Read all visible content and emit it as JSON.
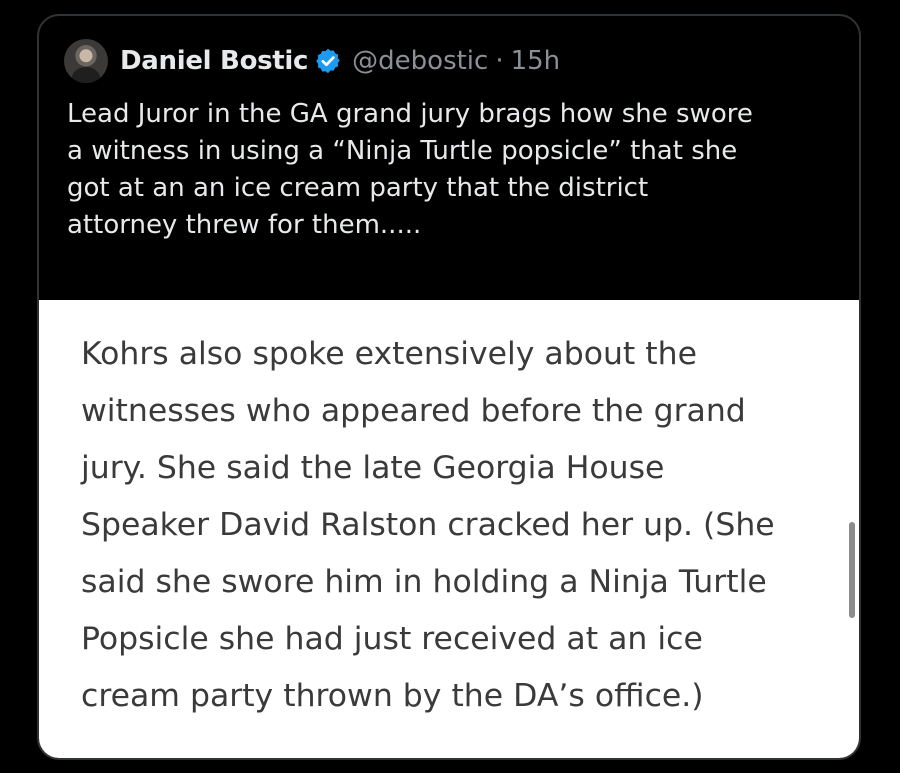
{
  "post": {
    "author_name": "Daniel Bostic",
    "handle": "@debostic",
    "separator": "·",
    "time": "15h",
    "text": "Lead Juror in the GA grand jury brags how she swore\na witness in using a “Ninja Turtle popsicle” that she\ngot at an an ice cream party that the district\nattorney threw for them.....",
    "verified_color": "#1d9bf0"
  },
  "media": {
    "text": "Kohrs also spoke extensively about the\nwitnesses who appeared before the grand\njury. She said the late Georgia House\nSpeaker David Ralston cracked her up. (She\nsaid she swore him in holding a Ninja Turtle\nPopsicle she had just received at an ice\ncream party thrown by the DA’s office.)"
  },
  "icons": {
    "avatar": "avatar-image",
    "verified": "verified-badge-icon"
  }
}
